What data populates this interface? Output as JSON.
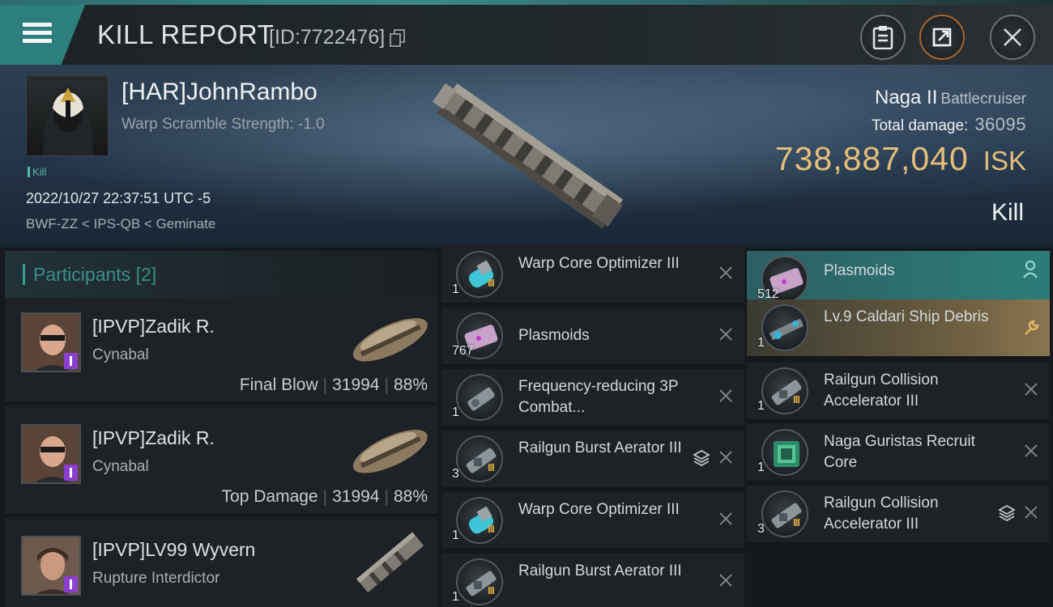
{
  "header": {
    "title": "KILL REPORT",
    "id_label": "[ID:7722476]"
  },
  "victim": {
    "name": "[HAR]JohnRambo",
    "warp_scramble": "Warp Scramble Strength: -1.0",
    "tag": "Kill",
    "timestamp": "2022/10/27 22:37:51 UTC -5",
    "location": "BWF-ZZ < IPS-QB < Geminate",
    "ship_name": "Naga II",
    "ship_class": "Battlecruiser",
    "total_damage_label": "Total damage:",
    "total_damage": "36095",
    "isk_value": "738,887,040",
    "isk_unit": "ISK",
    "result": "Kill"
  },
  "participants": {
    "title": "Participants",
    "count": "[2]",
    "list": [
      {
        "name": "[IPVP]Zadik R.",
        "ship": "Cynabal",
        "role": "Final Blow",
        "damage": "31994",
        "percent": "88%"
      },
      {
        "name": "[IPVP]Zadik R.",
        "ship": "Cynabal",
        "role": "Top Damage",
        "damage": "31994",
        "percent": "88%"
      },
      {
        "name": "[IPVP]LV99 Wyvern",
        "ship": "Rupture Interdictor",
        "role": "",
        "damage": "",
        "percent": ""
      }
    ]
  },
  "items_left": [
    {
      "qty": "1",
      "name": "Warp Core Optimizer III",
      "tier": "III",
      "icon": "warp-core-icon"
    },
    {
      "qty": "767",
      "name": "Plasmoids",
      "tier": "",
      "icon": "plasmoid-icon"
    },
    {
      "qty": "1",
      "name": "Frequency-reducing 3P Combat...",
      "tier": "",
      "icon": "module-icon"
    },
    {
      "qty": "3",
      "name": "Railgun Burst Aerator III",
      "tier": "III",
      "icon": "railgun-module-icon"
    },
    {
      "qty": "1",
      "name": "Warp Core Optimizer III",
      "tier": "III",
      "icon": "warp-core-icon"
    },
    {
      "qty": "1",
      "name": "Railgun Burst Aerator III",
      "tier": "III",
      "icon": "railgun-module-icon"
    }
  ],
  "items_right": [
    {
      "qty": "512",
      "name": "Plasmoids",
      "tier": "",
      "icon": "plasmoid-icon"
    },
    {
      "qty": "1",
      "name": "Lv.9 Caldari Ship Debris",
      "tier": "",
      "icon": "debris-icon"
    },
    {
      "qty": "1",
      "name": "Railgun Collision Accelerator III",
      "tier": "III",
      "icon": "railgun-module-icon"
    },
    {
      "qty": "1",
      "name": "Naga Guristas Recruit Core",
      "tier": "",
      "icon": "core-icon"
    },
    {
      "qty": "3",
      "name": "Railgun Collision Accelerator III",
      "tier": "III",
      "icon": "railgun-module-icon"
    }
  ],
  "colors": {
    "accent_teal": "#2c7f7c",
    "isk_gold": "#e3bf7a",
    "tier_gold": "#d4a640",
    "badge_purple": "#8a3fcf"
  }
}
